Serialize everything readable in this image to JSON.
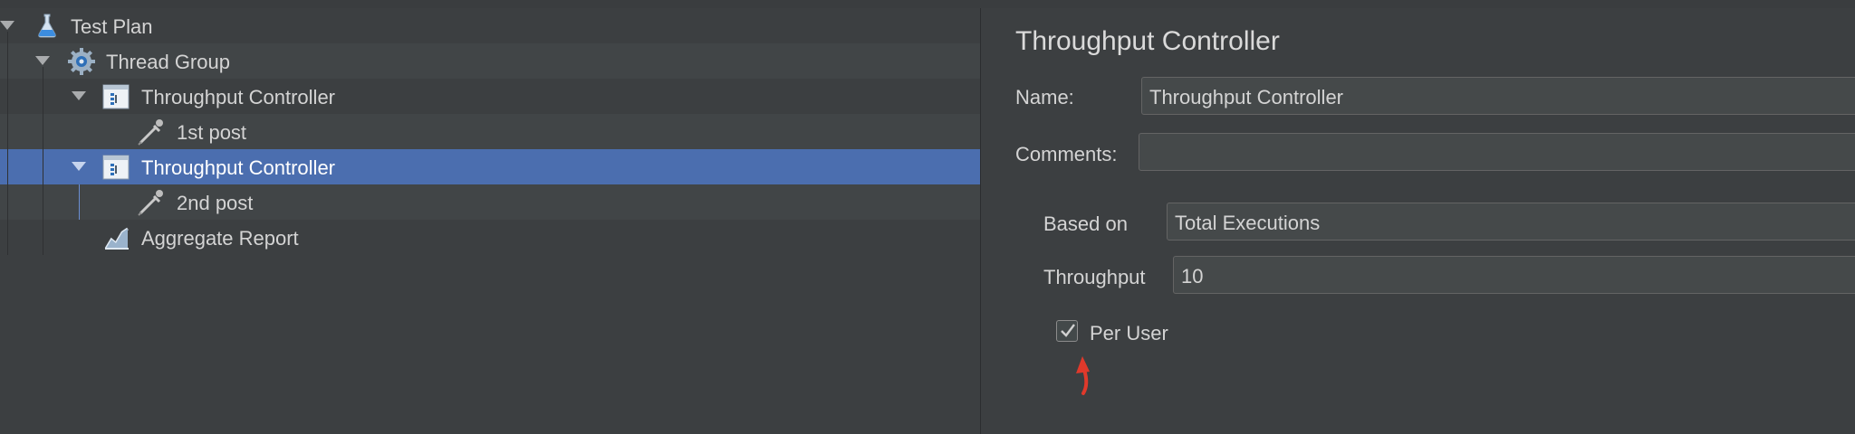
{
  "tree": {
    "items": [
      {
        "label": "Test Plan",
        "icon": "flask-icon"
      },
      {
        "label": "Thread Group",
        "icon": "gear-icon"
      },
      {
        "label": "Throughput Controller",
        "icon": "controller-icon"
      },
      {
        "label": "1st post",
        "icon": "pipette-icon"
      },
      {
        "label": "Throughput Controller",
        "icon": "controller-icon",
        "selected": true
      },
      {
        "label": "2nd post",
        "icon": "pipette-icon"
      },
      {
        "label": "Aggregate Report",
        "icon": "report-chart-icon"
      }
    ]
  },
  "panel": {
    "title": "Throughput Controller",
    "name_label": "Name:",
    "name_value": "Throughput Controller",
    "comments_label": "Comments:",
    "comments_value": "",
    "based_on_label": "Based on",
    "based_on_value": "Total Executions",
    "throughput_label": "Throughput",
    "throughput_value": "10",
    "per_user_label": "Per User",
    "per_user_checked": true
  },
  "colors": {
    "background": "#3c3f41",
    "selection": "#4b6eaf",
    "annotation_arrow": "#e0392b"
  }
}
